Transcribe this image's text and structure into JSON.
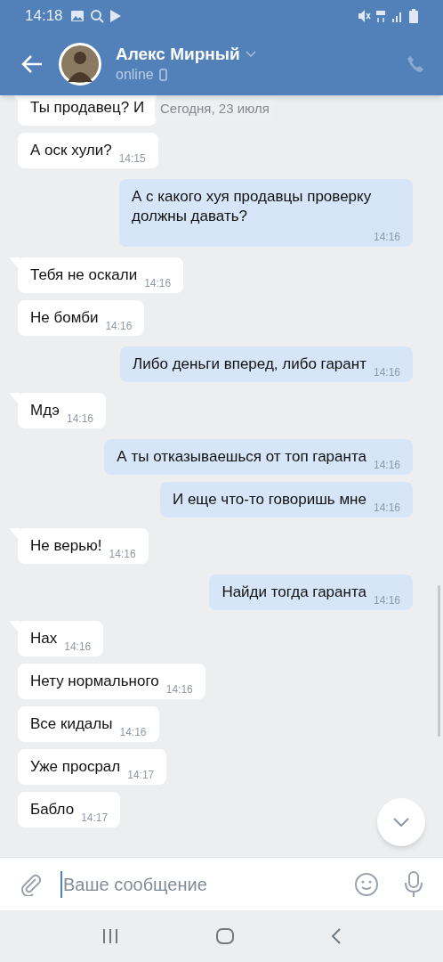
{
  "status_bar": {
    "time": "14:18"
  },
  "header": {
    "name": "Алекс Мирный",
    "status": "online",
    "call_disabled": true
  },
  "date_pill": "Сегодня, 23 июля",
  "messages": [
    {
      "kind": "incoming",
      "text": "Ты продавец? И",
      "tail": true
    },
    {
      "kind": "incoming",
      "text": "А оск хули?",
      "time": "14:15",
      "tail": false
    },
    {
      "kind": "outgoing",
      "text": "А с какого хуя продавцы проверку должны давать?",
      "time": "14:16",
      "tail": false
    },
    {
      "kind": "incoming",
      "text": "Тебя не оскали",
      "time": "14:16",
      "tail": true
    },
    {
      "kind": "incoming",
      "text": "Не бомби",
      "time": "14:16",
      "tail": false
    },
    {
      "kind": "outgoing",
      "text": "Либо деньги вперед, либо гарант",
      "time": "14:16",
      "tail": false
    },
    {
      "kind": "incoming",
      "text": "Мдэ",
      "time": "14:16",
      "tail": true
    },
    {
      "kind": "outgoing",
      "text": "А ты отказываешься от топ гаранта",
      "time": "14:16",
      "tail": false
    },
    {
      "kind": "outgoing",
      "text": "И еще что-то говоришь мне",
      "time": "14:16",
      "tail": false
    },
    {
      "kind": "incoming",
      "text": "Не верью!",
      "time": "14:16",
      "tail": true
    },
    {
      "kind": "outgoing",
      "text": "Найди тогда гаранта",
      "time": "14:16",
      "tail": false
    },
    {
      "kind": "incoming",
      "text": "Нах",
      "time": "14:16",
      "tail": true
    },
    {
      "kind": "incoming",
      "text": "Нету нормального",
      "time": "14:16",
      "tail": false
    },
    {
      "kind": "incoming",
      "text": "Все кидалы",
      "time": "14:16",
      "tail": false
    },
    {
      "kind": "incoming",
      "text": "Уже просрал",
      "time": "14:17",
      "tail": false
    },
    {
      "kind": "incoming",
      "text": "Бабло",
      "time": "14:17",
      "tail": false
    }
  ],
  "composer": {
    "placeholder": "Ваше сообщение"
  }
}
